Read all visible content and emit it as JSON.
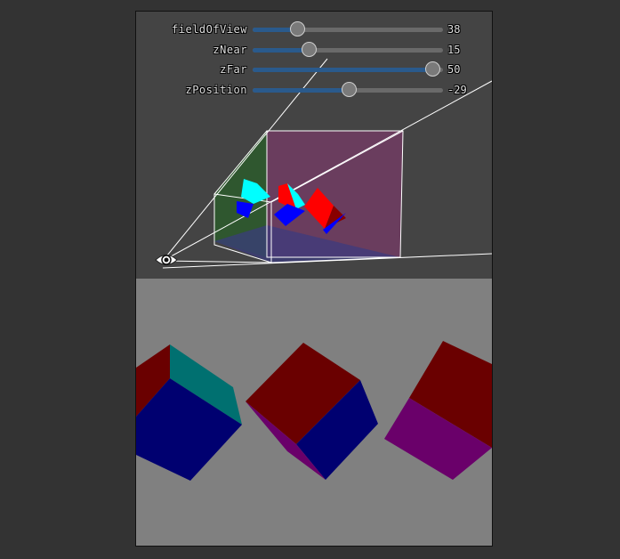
{
  "controls": [
    {
      "label": "fieldOfView",
      "value": "38",
      "fraction": 0.24
    },
    {
      "label": "zNear",
      "value": "15",
      "fraction": 0.3
    },
    {
      "label": "zFar",
      "value": "50",
      "fraction": 0.95
    },
    {
      "label": "zPosition",
      "value": "-29",
      "fraction": 0.51
    }
  ],
  "colors": {
    "page_background": "#333333",
    "top_view_background": "#444444",
    "bottom_view_background": "#808080",
    "slider_fill": "#2a5a8c",
    "frustum_lines": "#ffffff",
    "cube_red": "#ff0000",
    "cube_cyan": "#00ffff",
    "cube_blue": "#0000ff"
  },
  "icons": {
    "camera": "eye-icon"
  }
}
